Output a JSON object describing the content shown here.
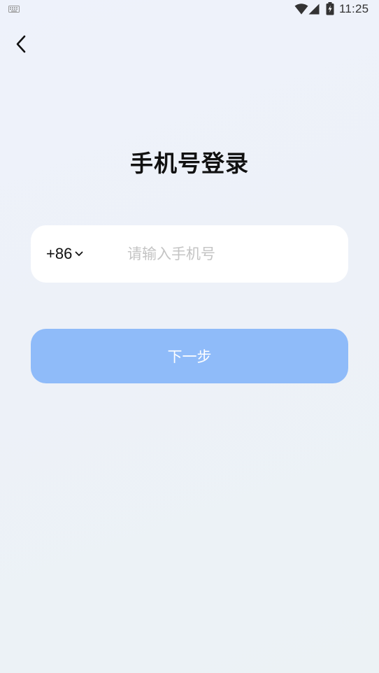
{
  "status_bar": {
    "time": "11:25",
    "icons": [
      "keyboard-icon",
      "wifi-icon",
      "signal-icon",
      "battery-charging-icon"
    ]
  },
  "header": {
    "back_icon": "chevron-left-icon"
  },
  "page_title": "手机号登录",
  "phone_form": {
    "country_code": "+86",
    "country_code_icon": "chevron-down-icon",
    "phone_value": "",
    "phone_placeholder": "请输入手机号"
  },
  "next_button_label": "下一步",
  "colors": {
    "background": "#eef2f9",
    "card": "#ffffff",
    "button": "#8fbbf9",
    "button_text": "#ffffff",
    "placeholder": "#c4c4c4",
    "title": "#111111"
  }
}
